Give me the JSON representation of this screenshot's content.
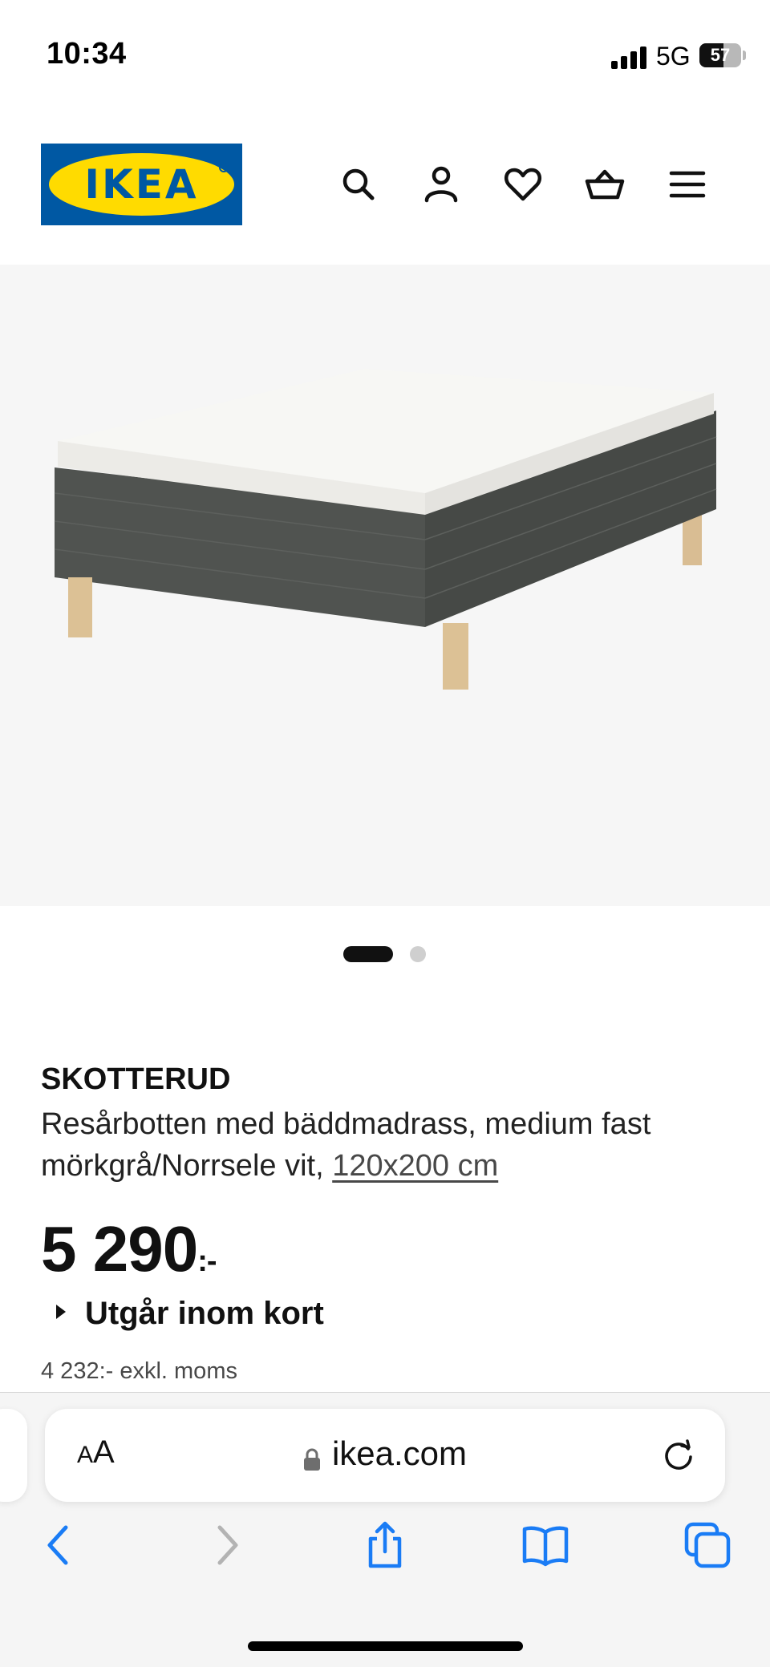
{
  "status_bar": {
    "time": "10:34",
    "network": "5G",
    "battery_level": "57"
  },
  "header": {
    "logo_text": "IKEA",
    "icons": [
      "search-icon",
      "user-icon",
      "heart-icon",
      "basket-icon",
      "menu-icon"
    ]
  },
  "gallery": {
    "slide_count": 2,
    "active_slide": 1
  },
  "product": {
    "name": "SKOTTERUD",
    "description": "Resårbotten med bäddmadrass, medium fast mörkgrå/Norrsele vit, ",
    "size_link": "120x200 cm",
    "price_main": "5 290",
    "price_suffix": ":-",
    "availability": "Utgår inom kort",
    "price_excl_vat": "4 232:- exkl. moms"
  },
  "browser": {
    "text_size_label_large": "A",
    "text_size_label_small": "A",
    "url": "ikea.com",
    "toolbar_icons": [
      "back-icon",
      "forward-icon",
      "share-icon",
      "bookmarks-icon",
      "tabs-icon"
    ]
  },
  "colors": {
    "ikea_blue": "#0058a3",
    "ikea_yellow": "#ffdb00",
    "safari_blue": "#1a7cf5"
  }
}
